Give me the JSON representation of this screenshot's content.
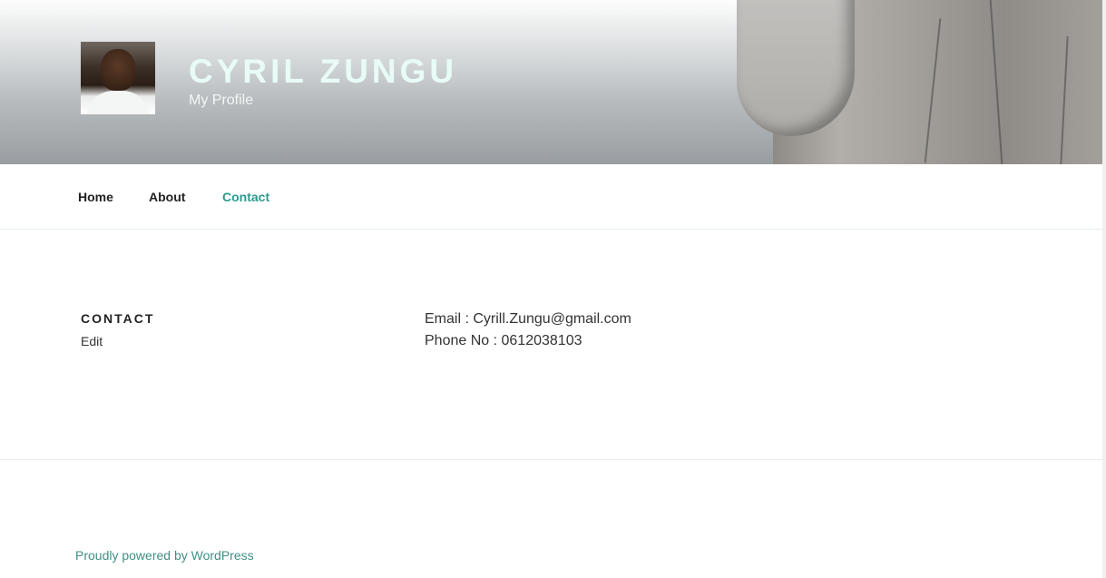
{
  "header": {
    "site_title": "CYRIL ZUNGU",
    "site_description": "My Profile"
  },
  "nav": {
    "items": [
      {
        "label": "Home"
      },
      {
        "label": "About"
      },
      {
        "label": "Contact"
      }
    ],
    "active": "Contact"
  },
  "page": {
    "title": "CONTACT",
    "edit_label": "Edit",
    "email_line": "Email : Cyrill.Zungu@gmail.com",
    "phone_line": "Phone No : 0612038103"
  },
  "footer": {
    "text": "Proudly powered by WordPress"
  },
  "colors": {
    "accent": "#2d9a8e",
    "title": "#e8fbf6"
  }
}
